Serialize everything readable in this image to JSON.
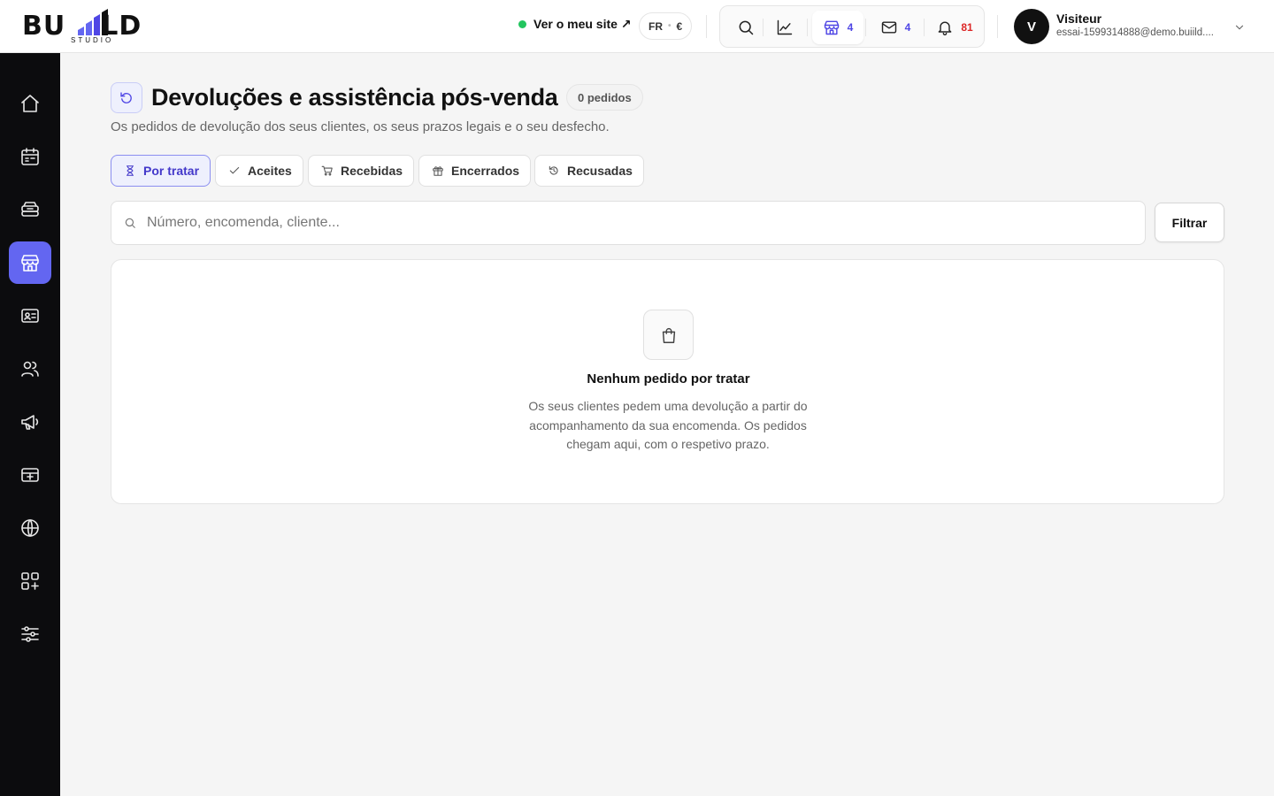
{
  "brand": {
    "logo_left": "BU",
    "logo_right": "LD",
    "logo_sub": "STUDIO"
  },
  "header": {
    "site_link": "Ver o meu site ↗",
    "lang": "FR",
    "currency": "€",
    "tools": {
      "store_count": "4",
      "mail_count": "4",
      "notifications_count": "81"
    },
    "user": {
      "initial": "V",
      "name": "Visiteur",
      "email": "essai-1599314888@demo.buiild...."
    }
  },
  "sidebar": {
    "items": [
      {
        "icon": "home-icon"
      },
      {
        "icon": "calendar-icon"
      },
      {
        "icon": "inbox-stack-icon"
      },
      {
        "icon": "store-icon",
        "active": true
      },
      {
        "icon": "id-card-icon"
      },
      {
        "icon": "users-icon"
      },
      {
        "icon": "megaphone-icon"
      },
      {
        "icon": "payment-card-icon"
      },
      {
        "icon": "globe-icon"
      },
      {
        "icon": "apps-add-icon"
      },
      {
        "icon": "sliders-icon"
      }
    ]
  },
  "page": {
    "title": "Devoluções e assistência pós-venda",
    "count_badge": "0 pedidos",
    "subtitle": "Os pedidos de devolução dos seus clientes, os seus prazos legais e o seu desfecho.",
    "tabs": [
      {
        "label": "Por tratar",
        "icon": "hourglass-icon",
        "active": true
      },
      {
        "label": "Aceites",
        "icon": "check-icon"
      },
      {
        "label": "Recebidas",
        "icon": "cart-icon"
      },
      {
        "label": "Encerrados",
        "icon": "gift-icon"
      },
      {
        "label": "Recusadas",
        "icon": "history-icon"
      }
    ],
    "search": {
      "placeholder": "Número, encomenda, cliente..."
    },
    "filter_label": "Filtrar",
    "empty": {
      "title": "Nenhum pedido por tratar",
      "text": "Os seus clientes pedem uma devolução a partir do acompanhamento da sua encomenda. Os pedidos chegam aqui, com o respetivo prazo."
    }
  },
  "colors": {
    "accent": "#6366f1",
    "sidebar_bg": "#0c0c0e",
    "status_green": "#22c55e",
    "badge_red": "#dc2626"
  }
}
